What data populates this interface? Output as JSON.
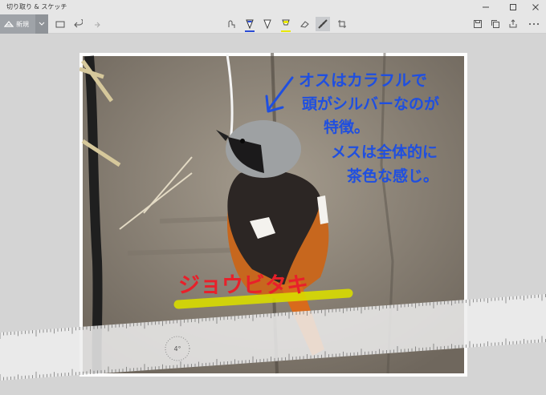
{
  "app": {
    "title": "切り取り & スケッチ"
  },
  "toolbar": {
    "new_label": "新規",
    "active_tool": "eraser/pencil",
    "pen_colors": {
      "ballpoint": "#2a4bd4",
      "pencil": "#444444",
      "highlighter": "#e8e800"
    }
  },
  "ruler": {
    "angle_label": "4°"
  },
  "annotations": {
    "blue_text": [
      "オスはカラフルで",
      "頭がシルバーなのが",
      "特徴。",
      "メスは全体的に",
      "茶色な感じ。"
    ],
    "red_text": "ジョウビタキ",
    "colors": {
      "blue": "#1f4fe0",
      "red": "#e8202a",
      "highlight": "#d9dc00"
    }
  }
}
